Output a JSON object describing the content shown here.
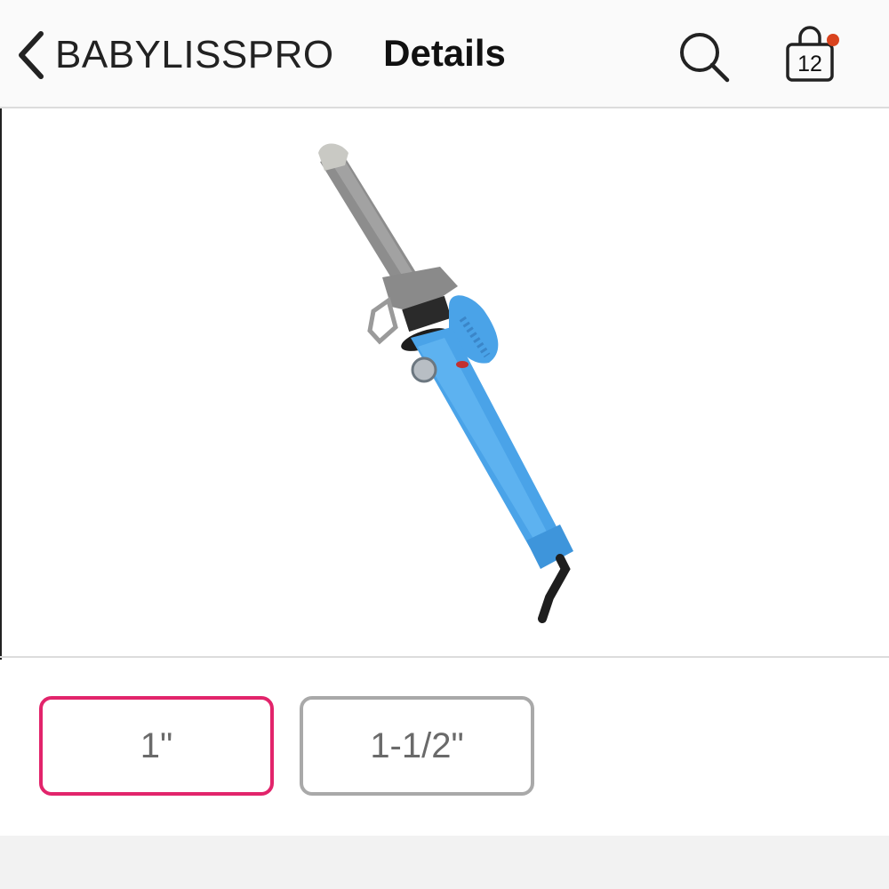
{
  "header": {
    "back_label": "BABYLISSPRO",
    "title": "Details",
    "back_icon": "chevron-left-icon",
    "search_icon": "search-icon",
    "cart_icon": "shopping-bag-icon",
    "cart_count": "12",
    "cart_dot_color": "#d9431e"
  },
  "product": {
    "image_icon": "curling-iron-image",
    "accent_color": "#4aa3e8"
  },
  "variants": {
    "options": [
      "1\"",
      "1-1/2\""
    ],
    "selected": "1\"",
    "selected_color": "#e2246b"
  }
}
